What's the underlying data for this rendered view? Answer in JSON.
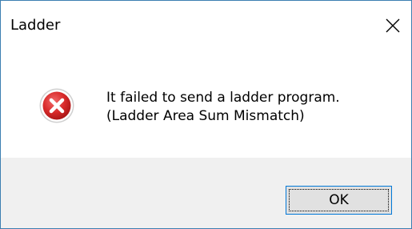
{
  "window": {
    "title": "Ladder",
    "close_icon": "close-icon"
  },
  "message": {
    "icon": "error-icon",
    "line1": "It failed to send a ladder program.",
    "line2": "(Ladder Area Sum Mismatch)"
  },
  "buttons": {
    "ok_label": "OK"
  },
  "colors": {
    "border": "#3c7fb1",
    "footer_bg": "#f0f0f0",
    "button_bg": "#e1e1e1",
    "button_border": "#0078d7",
    "error_red": "#d32f2f"
  }
}
